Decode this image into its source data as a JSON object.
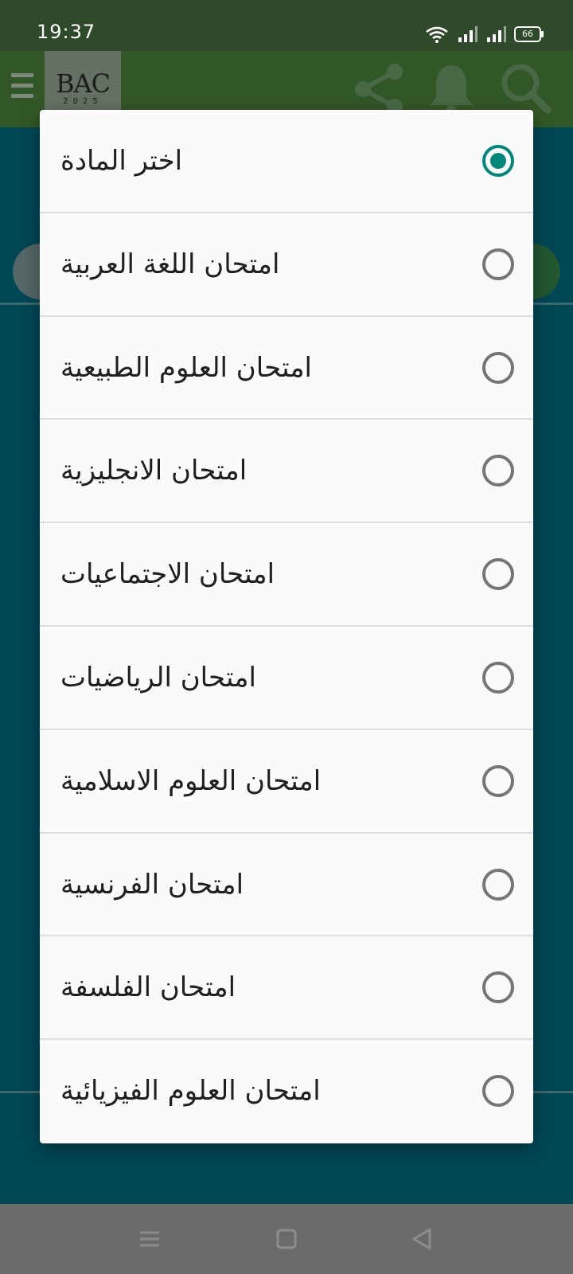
{
  "status_bar": {
    "time": "19:37",
    "battery_level": "66",
    "icons": [
      "wifi-icon",
      "signal-icon",
      "signal-icon",
      "battery-icon"
    ]
  },
  "app_toolbar": {
    "logo_main": "BAC",
    "logo_sub": "2025",
    "icons": [
      "menu-icon",
      "share-icon",
      "bell-icon",
      "search-icon"
    ]
  },
  "dialog": {
    "selected_index": 0,
    "accent_color": "#00897b",
    "options": [
      {
        "label": "اختر المادة",
        "checked": true
      },
      {
        "label": "امتحان اللغة العربية",
        "checked": false
      },
      {
        "label": "امتحان العلوم الطبيعية",
        "checked": false
      },
      {
        "label": "امتحان الانجليزية",
        "checked": false
      },
      {
        "label": "امتحان الاجتماعيات",
        "checked": false
      },
      {
        "label": "امتحان الرياضيات",
        "checked": false
      },
      {
        "label": "امتحان العلوم الاسلامية",
        "checked": false
      },
      {
        "label": "امتحان الفرنسية",
        "checked": false
      },
      {
        "label": "امتحان الفلسفة",
        "checked": false
      },
      {
        "label": "امتحان العلوم الفيزيائية",
        "checked": false
      }
    ]
  },
  "nav_bar": {
    "icons": [
      "recents-icon",
      "home-icon",
      "back-icon"
    ]
  }
}
